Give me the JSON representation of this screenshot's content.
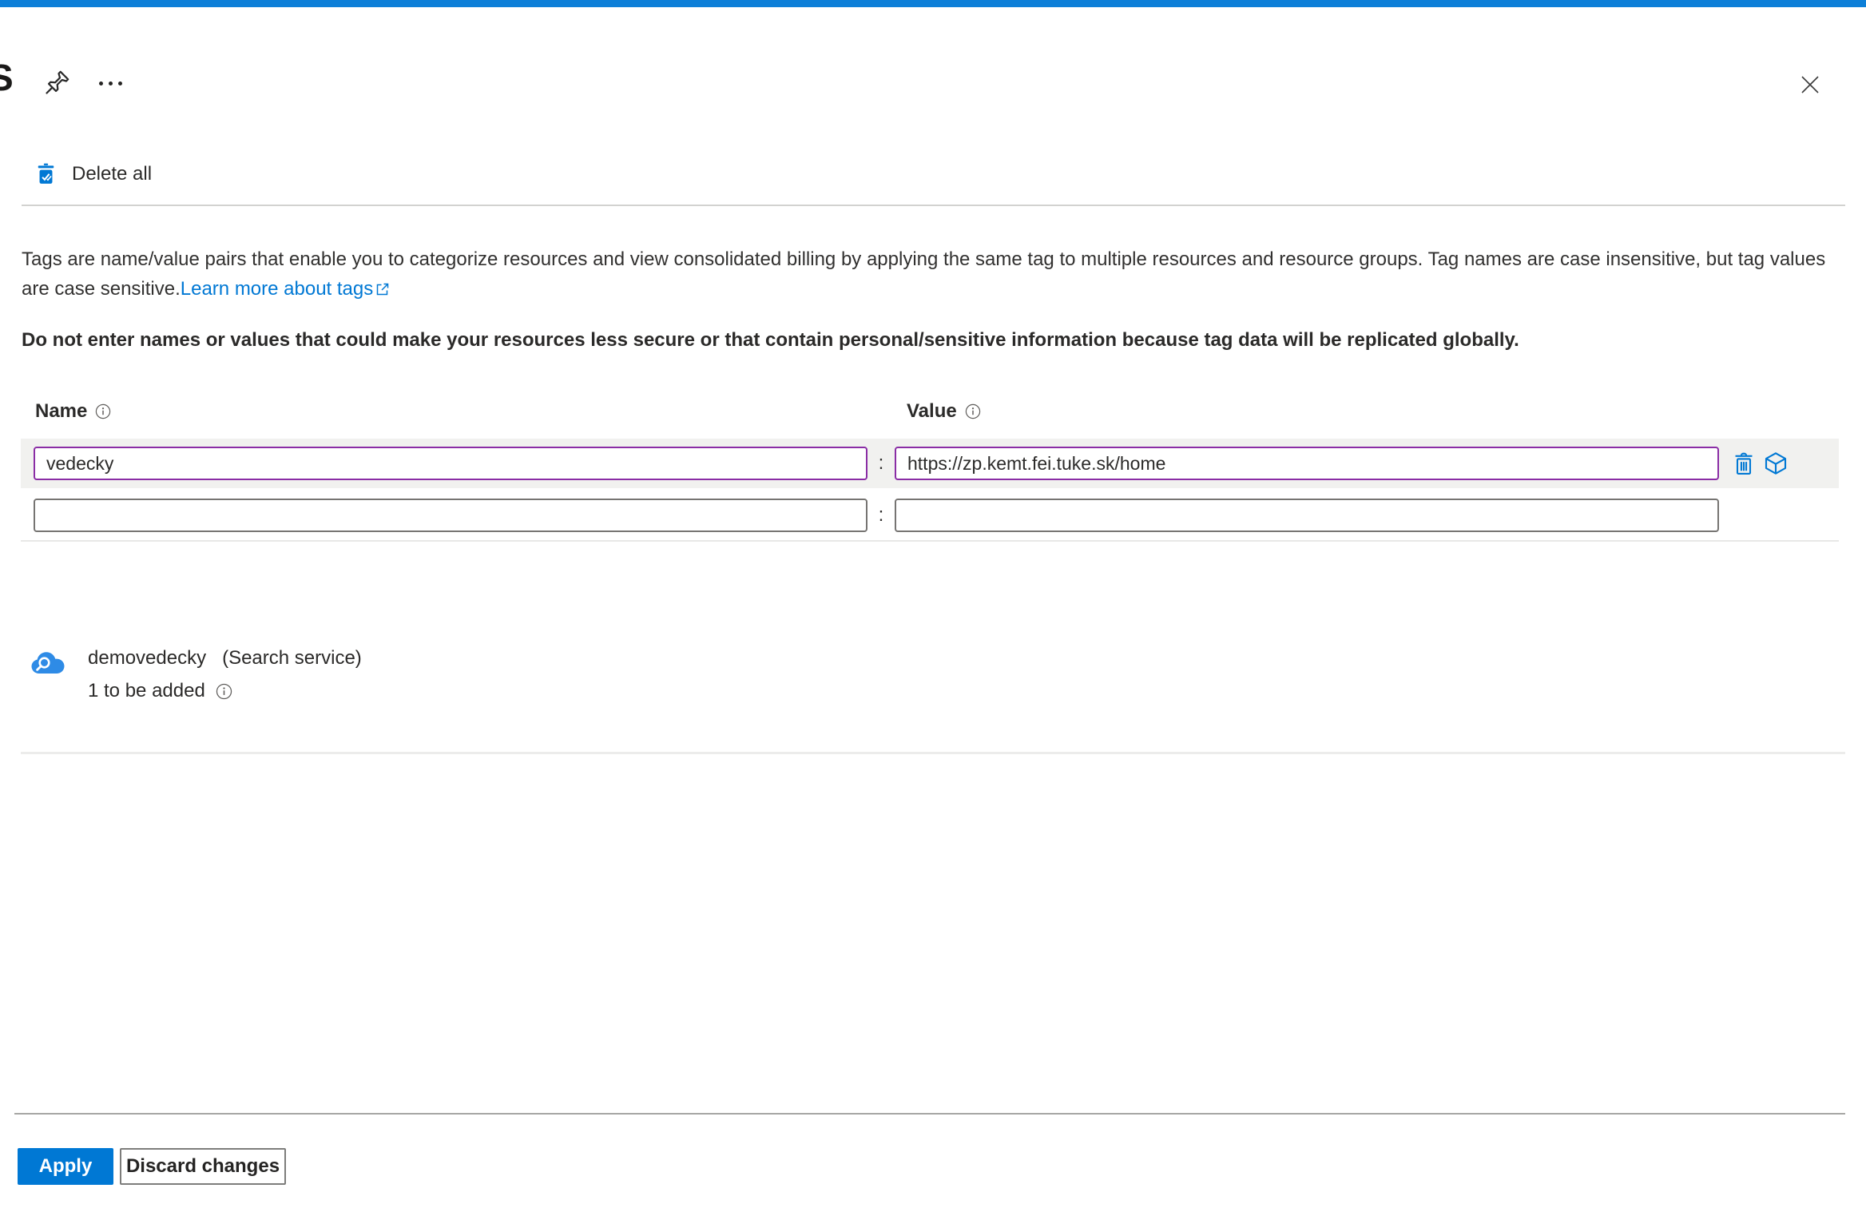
{
  "header": {
    "title_fragment": "S"
  },
  "toolbar": {
    "delete_all_label": "Delete all"
  },
  "description": {
    "body": "Tags are name/value pairs that enable you to categorize resources and view consolidated billing by applying the same tag to multiple resources and resource groups. Tag names are case insensitive, but tag values are case sensitive.",
    "link_label": "Learn more about tags",
    "warning": "Do not enter names or values that could make your resources less secure or that contain personal/sensitive information because tag data will be replicated globally."
  },
  "tag_editor": {
    "name_header": "Name",
    "value_header": "Value",
    "separator": ":",
    "rows": [
      {
        "name": "vedecky",
        "value": "https://zp.kemt.fei.tuke.sk/home"
      },
      {
        "name": "",
        "value": ""
      }
    ]
  },
  "resource_summary": {
    "resource_name": "demovedecky",
    "resource_type": "(Search service)",
    "pending_status": "1 to be added"
  },
  "footer": {
    "apply_label": "Apply",
    "discard_label": "Discard changes"
  },
  "icons": {
    "pin": "pushpin",
    "more": "ellipsis",
    "close": "x",
    "delete_all": "trash-with-checkmarks",
    "info": "circle-i",
    "external_link": "box-arrow",
    "delete_row": "trash-outline",
    "resource_cube": "cube-outline",
    "search_service": "cloud-magnifier"
  },
  "colors": {
    "accent_blue": "#0078d4",
    "modified_field_purple": "#8a2da5",
    "row_highlight": "#f1f1ef",
    "link_blue": "#0078d4",
    "top_bar_blue": "#0d7fd8"
  }
}
